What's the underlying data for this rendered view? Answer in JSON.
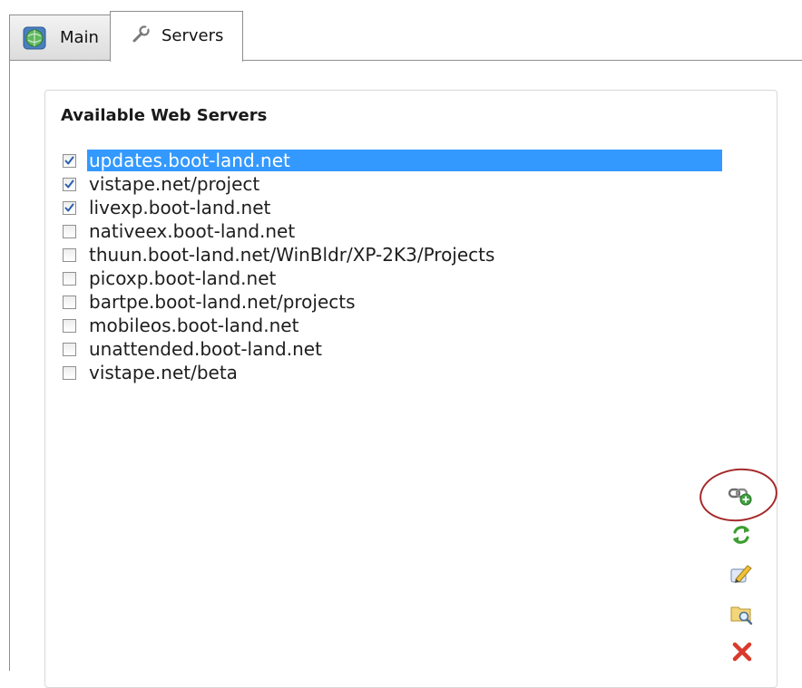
{
  "tabs": [
    {
      "label": "Main",
      "icon": "globe-icon",
      "active": false
    },
    {
      "label": "Servers",
      "icon": "wrench-icon",
      "active": true
    }
  ],
  "group_title": "Available Web Servers",
  "servers": [
    {
      "label": "updates.boot-land.net",
      "checked": true,
      "selected": true
    },
    {
      "label": "vistape.net/project",
      "checked": true,
      "selected": false
    },
    {
      "label": "livexp.boot-land.net",
      "checked": true,
      "selected": false
    },
    {
      "label": "nativeex.boot-land.net",
      "checked": false,
      "selected": false
    },
    {
      "label": "thuun.boot-land.net/WinBldr/XP-2K3/Projects",
      "checked": false,
      "selected": false
    },
    {
      "label": "picoxp.boot-land.net",
      "checked": false,
      "selected": false
    },
    {
      "label": "bartpe.boot-land.net/projects",
      "checked": false,
      "selected": false
    },
    {
      "label": "mobileos.boot-land.net",
      "checked": false,
      "selected": false
    },
    {
      "label": "unattended.boot-land.net",
      "checked": false,
      "selected": false
    },
    {
      "label": "vistape.net/beta",
      "checked": false,
      "selected": false
    }
  ],
  "actions": [
    {
      "icon": "add-link-icon"
    },
    {
      "icon": "refresh-icon"
    },
    {
      "icon": "edit-icon"
    },
    {
      "icon": "browse-folder-icon"
    },
    {
      "icon": "delete-icon"
    }
  ],
  "colors": {
    "selection": "#3399ff",
    "annotation_circle": "#a52a2a",
    "check": "#2a5fb0"
  }
}
